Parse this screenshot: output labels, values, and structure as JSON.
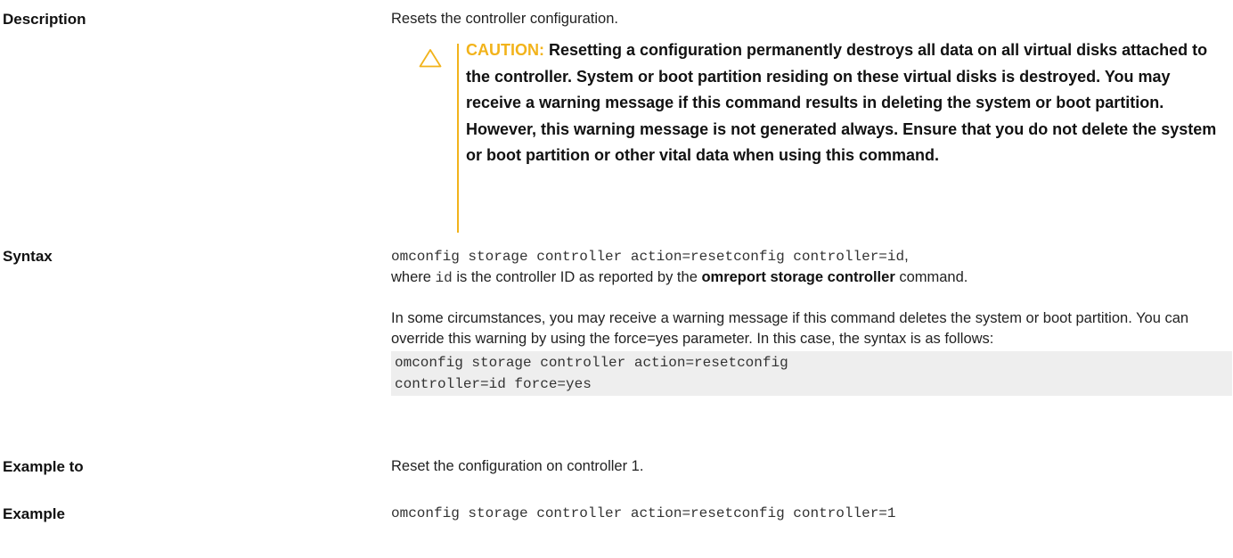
{
  "description": {
    "label": "Description",
    "text": "Resets the controller configuration.",
    "caution": {
      "label": "CAUTION:",
      "text": " Resetting a configuration permanently destroys all data on all virtual disks attached to the controller. System or boot partition residing on these virtual disks is destroyed. You may receive a warning message if this command results in deleting the system or boot partition. However, this warning message is not generated always. Ensure that you do not delete the system or boot partition or other vital data when using this command."
    }
  },
  "syntax": {
    "label": "Syntax",
    "command": "omconfig storage controller action=resetconfig controller=id",
    "comma": ",",
    "where": "where ",
    "id_code": "id",
    "mid": " is the controller ID as reported by the ",
    "ref": "omreport storage controller",
    "tail": " command.",
    "paragraph": "In some circumstances, you may receive a warning message if this command deletes the system or boot partition. You can override this warning by using the force=yes parameter. In this case, the syntax is as follows:",
    "code_line1": "omconfig storage controller action=resetconfig",
    "code_line2": "controller=id force=yes"
  },
  "example_to": {
    "label": "Example to",
    "text": "Reset the configuration on controller 1."
  },
  "example": {
    "label": "Example",
    "code": "omconfig storage controller action=resetconfig controller=1"
  },
  "colors": {
    "caution_accent": "#f2b31b",
    "code_background": "#eeeeee"
  }
}
